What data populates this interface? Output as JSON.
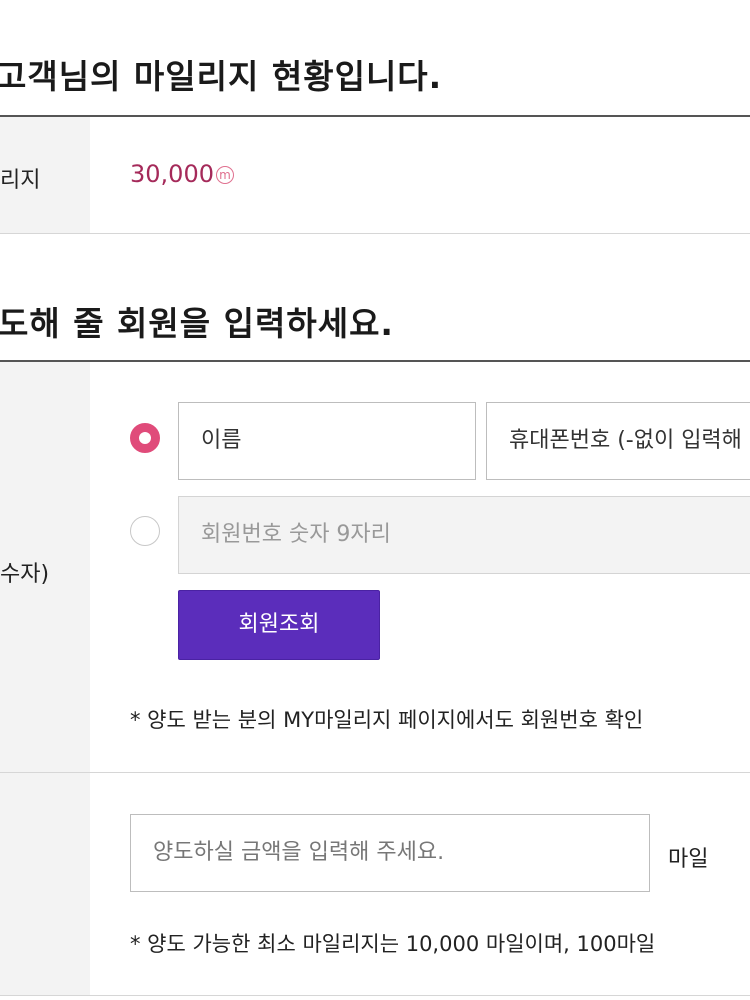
{
  "status_section": {
    "heading": "고객님의 마일리지 현황입니다.",
    "label": "리지",
    "amount": "30,000",
    "unit_badge": "m"
  },
  "transfer_section": {
    "heading": "도해 줄 회원을 입력하세요.",
    "recipient_label": "수자)",
    "name_field_value": "이름",
    "phone_field_value": "휴대폰번호 (-없이 입력해",
    "member_no_placeholder": "회원번호 숫자 9자리",
    "lookup_button": "회원조회",
    "note": "* 양도 받는 분의 MY마일리지 페이지에서도 회원번호 확인"
  },
  "amount_section": {
    "placeholder": "양도하실 금액을 입력해 주세요.",
    "unit": "마일",
    "note": "* 양도 가능한 최소 마일리지는 10,000 마일이며, 100마일"
  },
  "colors": {
    "accent_amount": "#a52a5a",
    "radio_selected": "#e04b7a",
    "button_primary": "#5b2dbb"
  }
}
